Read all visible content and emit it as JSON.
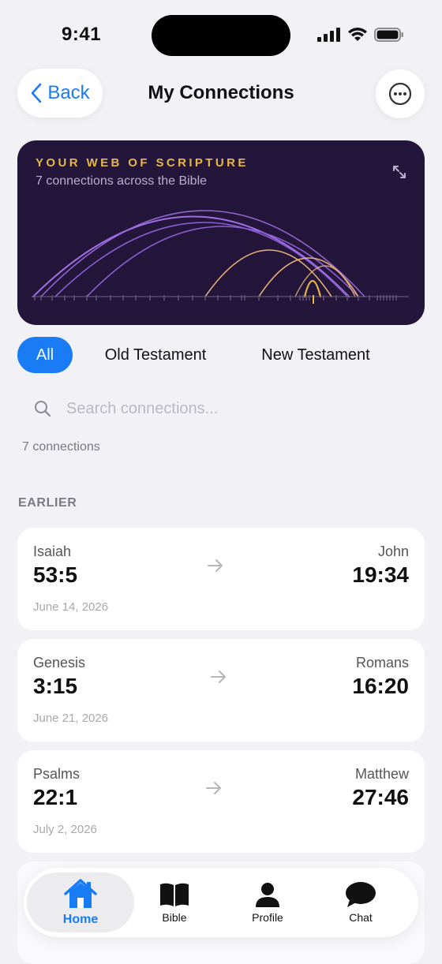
{
  "status_bar": {
    "time": "9:41"
  },
  "nav": {
    "back_label": "Back",
    "title": "My Connections"
  },
  "web_card": {
    "title": "YOUR WEB OF SCRIPTURE",
    "subtitle": "7 connections across the Bible"
  },
  "filters": [
    {
      "label": "All",
      "selected": true
    },
    {
      "label": "Old Testament",
      "selected": false
    },
    {
      "label": "New Testament",
      "selected": false
    }
  ],
  "search": {
    "placeholder": "Search connections..."
  },
  "count_label": "7 connections",
  "section_label": "EARLIER",
  "connections": [
    {
      "from_book": "Isaiah",
      "from_verse": "53:5",
      "to_book": "John",
      "to_verse": "19:34",
      "date": "June 14, 2026"
    },
    {
      "from_book": "Genesis",
      "from_verse": "3:15",
      "to_book": "Romans",
      "to_verse": "16:20",
      "date": "June 21, 2026"
    },
    {
      "from_book": "Psalms",
      "from_verse": "22:1",
      "to_book": "Matthew",
      "to_verse": "27:46",
      "date": "July 2, 2026"
    }
  ],
  "tabs": [
    {
      "label": "Home",
      "icon": "home-icon",
      "selected": true
    },
    {
      "label": "Bible",
      "icon": "book-icon",
      "selected": false
    },
    {
      "label": "Profile",
      "icon": "person-icon",
      "selected": false
    },
    {
      "label": "Chat",
      "icon": "chat-bubble-icon",
      "selected": false
    }
  ],
  "colors": {
    "accent": "#1a7cf5",
    "card_bg": "#24163a",
    "card_title": "#e6b648",
    "arc_purple": "#9f6fe0",
    "arc_gold": "#e6b07a"
  }
}
